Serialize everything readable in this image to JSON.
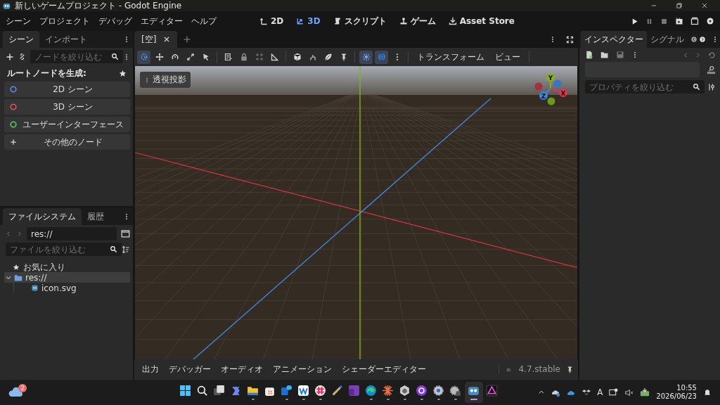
{
  "window": {
    "title": "新しいゲームプロジェクト - Godot Engine"
  },
  "menu": [
    "シーン",
    "プロジェクト",
    "デバッグ",
    "エディター",
    "ヘルプ"
  ],
  "workspaces": [
    {
      "kind": "flat",
      "label": "2D",
      "selected": false
    },
    {
      "kind": "spatial",
      "label": "3D",
      "selected": true
    },
    {
      "kind": "script",
      "label": "スクリプト",
      "selected": false
    },
    {
      "kind": "game",
      "label": "ゲーム",
      "selected": false
    },
    {
      "kind": "asset",
      "label": "Asset Store",
      "selected": false
    }
  ],
  "scene_dock": {
    "tabs": [
      {
        "label": "シーン",
        "selected": true
      },
      {
        "label": "インポート",
        "selected": false
      }
    ],
    "filter": {
      "placeholder": "ノードを絞り込む"
    },
    "heading": "ルートノードを生成:",
    "root_buttons": [
      {
        "kind": "circle",
        "label": "2D シーン",
        "color": "#5b8ef0"
      },
      {
        "kind": "circle",
        "label": "3D シーン",
        "color": "#e5505c"
      },
      {
        "kind": "circle",
        "label": "ユーザーインターフェース",
        "color": "#4fd35f"
      },
      {
        "kind": "plus",
        "label": "その他のノード"
      }
    ]
  },
  "filesystem_dock": {
    "tabs": [
      {
        "label": "ファイルシステム",
        "selected": true
      },
      {
        "label": "履歴",
        "selected": false
      }
    ],
    "path": {
      "value": "res://"
    },
    "filter": {
      "placeholder": "ファイルを絞り込む"
    },
    "favorites": "お気に入り",
    "tree": [
      {
        "kind": "folder",
        "label": "res://",
        "selected": true,
        "expanded": true,
        "children": [
          {
            "kind": "file",
            "label": "icon.svg",
            "selected": false
          }
        ]
      }
    ]
  },
  "editor": {
    "tabs": [
      {
        "label": "[空]",
        "selected": true
      }
    ],
    "tools": [
      {
        "kind": "select",
        "selected": true
      },
      {
        "kind": "move",
        "selected": false
      },
      {
        "kind": "rotate",
        "selected": false
      },
      {
        "kind": "scale",
        "selected": false
      },
      {
        "kind": "pointer",
        "selected": false
      },
      {
        "kind": "sep"
      },
      {
        "kind": "list",
        "selected": false
      },
      {
        "kind": "lock",
        "selected": false
      },
      {
        "kind": "group",
        "selected": false
      },
      {
        "kind": "ruler",
        "selected": false
      },
      {
        "kind": "sep"
      },
      {
        "kind": "cube",
        "selected": false
      },
      {
        "kind": "bones",
        "selected": false
      },
      {
        "kind": "leaf",
        "selected": false
      },
      {
        "kind": "pin",
        "selected": false
      },
      {
        "kind": "sep"
      },
      {
        "kind": "sun",
        "selected": true
      },
      {
        "kind": "globe",
        "selected": true
      },
      {
        "kind": "more",
        "selected": false
      },
      {
        "kind": "sep"
      }
    ],
    "menus": [
      "トランスフォーム",
      "ビュー"
    ],
    "view_label": "透視投影",
    "gizmo": {
      "x": "X",
      "y": "Y",
      "z": "Z"
    }
  },
  "bottom_panel": {
    "tabs": [
      "出力",
      "デバッガー",
      "オーディオ",
      "アニメーション",
      "シェーダーエディター"
    ],
    "version": "4.7.stable"
  },
  "inspector": {
    "tabs": [
      {
        "label": "インスペクター",
        "selected": true
      },
      {
        "label": "シグナル",
        "selected": false
      }
    ],
    "filter": {
      "placeholder": "プロパティを絞り込む"
    }
  },
  "taskbar": {
    "weather_badge": "2",
    "apps": [
      {
        "kind": "start",
        "open": false,
        "selected": false
      },
      {
        "kind": "search",
        "open": false,
        "selected": false
      },
      {
        "kind": "taskview",
        "open": false,
        "selected": false
      },
      {
        "kind": "copilot",
        "open": false,
        "selected": false
      },
      {
        "kind": "explorer",
        "open": true,
        "selected": false
      },
      {
        "kind": "store",
        "open": false,
        "selected": false
      },
      {
        "kind": "outlook",
        "open": true,
        "selected": false
      },
      {
        "kind": "wapp",
        "open": true,
        "selected": false
      },
      {
        "kind": "slack",
        "open": true,
        "selected": false
      },
      {
        "kind": "pen",
        "open": false,
        "selected": false
      },
      {
        "kind": "onenote",
        "open": false,
        "selected": false
      },
      {
        "kind": "edge",
        "open": true,
        "selected": false
      },
      {
        "kind": "burst",
        "open": true,
        "selected": false
      },
      {
        "kind": "hexagon",
        "open": true,
        "selected": false
      },
      {
        "kind": "github",
        "open": true,
        "selected": false
      },
      {
        "kind": "gear",
        "open": true,
        "selected": false
      },
      {
        "kind": "gear2",
        "open": true,
        "selected": false
      },
      {
        "kind": "godot",
        "open": true,
        "selected": true
      },
      {
        "kind": "dark",
        "open": false,
        "selected": false
      }
    ],
    "ime": "A",
    "time": "10:55",
    "date": "2026/06/23"
  }
}
